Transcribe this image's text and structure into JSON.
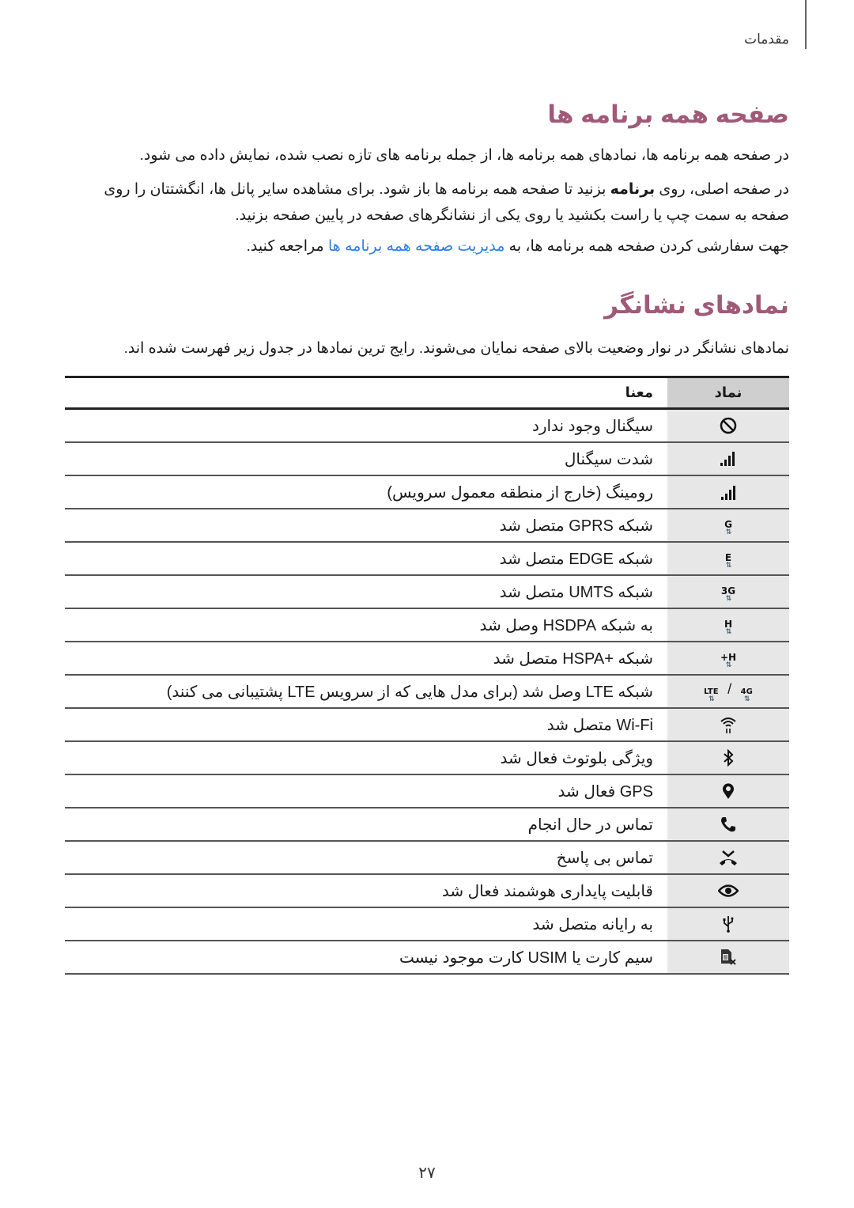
{
  "header": {
    "chapter_label": "مقدمات"
  },
  "section1": {
    "title": "صفحه همه برنامه ها",
    "para1": "در صفحه همه برنامه ها، نمادهای همه برنامه ها، از جمله برنامه های تازه نصب شده، نمایش داده می شود.",
    "para2_pre": "در صفحه اصلی، روی ",
    "para2_bold": "برنامه",
    "para2_post": " بزنید تا صفحه همه برنامه ها باز شود. برای مشاهده سایر پانل ها، انگشتتان را روی صفحه به سمت چپ یا راست بکشید یا روی یکی از نشانگرهای صفحه در پایین صفحه بزنید.",
    "para3_pre": "جهت سفارشی کردن صفحه همه برنامه ها، به ",
    "para3_link": "مدیریت صفحه همه برنامه ها",
    "para3_post": " مراجعه کنید."
  },
  "section2": {
    "title": "نمادهای نشانگر",
    "para1": "نمادهای نشانگر در نوار وضعیت بالای صفحه نمایان می‌شوند. رایج ترین نمادها در جدول زیر فهرست شده اند."
  },
  "table": {
    "headers": {
      "symbol": "نماد",
      "meaning": "معنا"
    },
    "rows": [
      {
        "icon": "no-signal-icon",
        "meaning": "سیگنال وجود ندارد"
      },
      {
        "icon": "signal-strength-icon",
        "meaning": "شدت سیگنال"
      },
      {
        "icon": "roaming-icon",
        "meaning": "رومینگ (خارج از منطقه معمول سرویس)"
      },
      {
        "icon": "gprs-icon",
        "icon_text": "G",
        "meaning": "شبکه GPRS متصل شد"
      },
      {
        "icon": "edge-icon",
        "icon_text": "E",
        "meaning": "شبکه EDGE متصل شد"
      },
      {
        "icon": "umts-icon",
        "icon_text": "3G",
        "meaning": "شبکه UMTS متصل شد"
      },
      {
        "icon": "hsdpa-icon",
        "icon_text": "H",
        "meaning": "به شبکه HSDPA وصل شد"
      },
      {
        "icon": "hspa-plus-icon",
        "icon_text": "H+",
        "meaning": "شبکه +HSPA متصل شد"
      },
      {
        "icon": "lte-4g-icon",
        "icon_text_a": "LTE",
        "icon_text_b": "4G",
        "separator": "/",
        "meaning": "شبکه LTE وصل شد (برای مدل هایی که از سرویس LTE پشتیبانی می کنند)"
      },
      {
        "icon": "wifi-icon",
        "meaning": "Wi-Fi متصل شد"
      },
      {
        "icon": "bluetooth-icon",
        "meaning": "ویژگی بلوتوث فعال شد"
      },
      {
        "icon": "gps-icon",
        "meaning": "GPS فعال شد"
      },
      {
        "icon": "call-in-progress-icon",
        "meaning": "تماس در حال انجام"
      },
      {
        "icon": "missed-call-icon",
        "meaning": "تماس بی پاسخ"
      },
      {
        "icon": "smart-stay-icon",
        "meaning": "قابلیت پایداری هوشمند فعال شد"
      },
      {
        "icon": "usb-icon",
        "meaning": "به رایانه متصل شد"
      },
      {
        "icon": "no-sim-icon",
        "meaning": "سیم کارت یا USIM کارت موجود نیست"
      }
    ]
  },
  "footer": {
    "page_number": "۲۷"
  },
  "colors": {
    "heading": "#a05a78",
    "link": "#2f7fe6",
    "symbol_col_bg": "#e7e7e7",
    "header_bg": "#cfcfcf"
  }
}
